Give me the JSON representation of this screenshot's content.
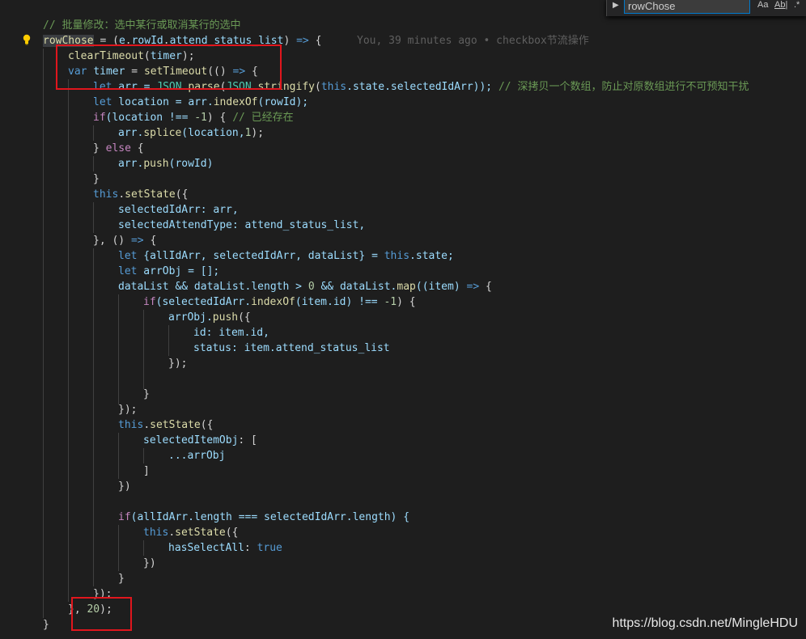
{
  "find": {
    "query": "rowChose",
    "opt_case": "Aa",
    "opt_word": "Ab|",
    "opt_regex": ".*"
  },
  "blame": "You, 39 minutes ago • checkbox节流操作",
  "watermark": "https://blog.csdn.net/MingleHDU",
  "code": {
    "l1_comment": "// 批量修改：选中某行或取消某行的选中",
    "l2_name": "rowChose",
    "l2_a": " = (",
    "l2_e": "e",
    "l2_b": ".",
    "l2_rowId": "rowId",
    "l2_c": ".",
    "l2_attend": "attend_status_list",
    "l2_d": ") ",
    "l2_arrow": "=>",
    "l2_e2": " {",
    "l3_fn": "clearTimeout",
    "l3_a": "(",
    "l3_timer": "timer",
    "l3_b": ");",
    "l4_var": "var",
    "l4_sp": " ",
    "l4_timer": "timer",
    "l4_eq": " = ",
    "l4_fn": "setTimeout",
    "l4_a": "(() ",
    "l4_arrow": "=>",
    "l4_b": " {",
    "l5_let": "let",
    "l5_a": " arr = ",
    "l5_json": "JSON",
    "l5_b": ".",
    "l5_parse": "parse",
    "l5_c": "(",
    "l5_json2": "JSON",
    "l5_d": ".",
    "l5_str": "stringify",
    "l5_e": "(",
    "l5_this": "this",
    "l5_f": ".state.selectedIdArr)); ",
    "l5_comment": "// 深拷贝一个数组，防止对原数组进行不可预知干扰",
    "l6_let": "let",
    "l6_a": " location = arr.",
    "l6_fn": "indexOf",
    "l6_b": "(rowId);",
    "l7_if": "if",
    "l7_a": "(location !== ",
    "l7_num": "-1",
    "l7_b": ") { ",
    "l7_comment": "// 已经存在",
    "l8_a": "arr.",
    "l8_fn": "splice",
    "l8_b": "(location,",
    "l8_num": "1",
    "l8_c": ");",
    "l9_a": "} ",
    "l9_else": "else",
    "l9_b": " {",
    "l10_a": "arr.",
    "l10_fn": "push",
    "l10_b": "(rowId)",
    "l11": "}",
    "l12_this": "this",
    "l12_a": ".",
    "l12_fn": "setState",
    "l12_b": "({",
    "l13_key": "selectedIdArr",
    "l13_a": ": arr,",
    "l14_key": "selectedAttendType",
    "l14_a": ": attend_status_list,",
    "l15_a": "}, () ",
    "l15_arrow": "=>",
    "l15_b": " {",
    "l16_let": "let",
    "l16_a": " {allIdArr, selectedIdArr, dataList} = ",
    "l16_this": "this",
    "l16_b": ".state;",
    "l17_let": "let",
    "l17_a": " arrObj = [];",
    "l18_a": "dataList && dataList.length > ",
    "l18_num": "0",
    "l18_b": " && dataList.",
    "l18_fn": "map",
    "l18_c": "((item) ",
    "l18_arrow": "=>",
    "l18_d": " {",
    "l19_if": "if",
    "l19_a": "(selectedIdArr.",
    "l19_fn": "indexOf",
    "l19_b": "(item.id) !== ",
    "l19_num": "-1",
    "l19_c": ") {",
    "l20_a": "arrObj.",
    "l20_fn": "push",
    "l20_b": "({",
    "l21_key": "id",
    "l21_a": ": item.id,",
    "l22_key": "status",
    "l22_a": ": item.attend_status_list",
    "l23": "});",
    "l25": "}",
    "l26": "});",
    "l27_this": "this",
    "l27_a": ".",
    "l27_fn": "setState",
    "l27_b": "({",
    "l28_key": "selectedItemObj",
    "l28_a": ": [",
    "l29": "...arrObj",
    "l30": "]",
    "l31": "})",
    "l33_if": "if",
    "l33_a": "(allIdArr.length === selectedIdArr.length) {",
    "l34_this": "this",
    "l34_a": ".",
    "l34_fn": "setState",
    "l34_b": "({",
    "l35_key": "hasSelectAll",
    "l35_a": ": ",
    "l35_true": "true",
    "l36": "})",
    "l37": "}",
    "l38": "});",
    "l39_a": "}, ",
    "l39_num": "20",
    "l39_b": ");",
    "l40": "}"
  },
  "colors": {
    "background": "#1e1e1e",
    "highlight_box": "#e0161d",
    "keyword": "#569cd6",
    "function": "#dcdcaa",
    "comment": "#6a9955"
  }
}
